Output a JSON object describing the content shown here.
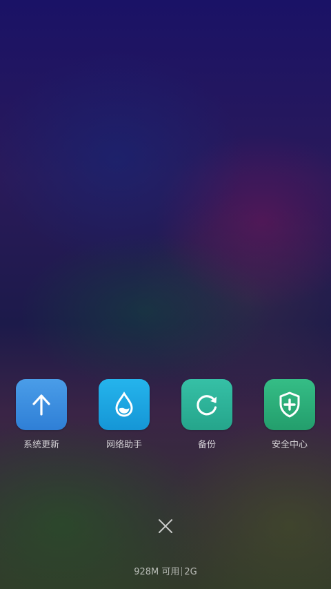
{
  "quick_actions": [
    {
      "label": "系统更新",
      "icon": "arrow-up-icon",
      "color": "#3b8ee0"
    },
    {
      "label": "网络助手",
      "icon": "water-drop-icon",
      "color": "#1aa6e0"
    },
    {
      "label": "备份",
      "icon": "refresh-icon",
      "color": "#2eb49a"
    },
    {
      "label": "安全中心",
      "icon": "shield-plus-icon",
      "color": "#2bb27a"
    }
  ],
  "close": {
    "icon": "close-icon"
  },
  "memory": {
    "available": "928M 可用",
    "total": "2G"
  }
}
